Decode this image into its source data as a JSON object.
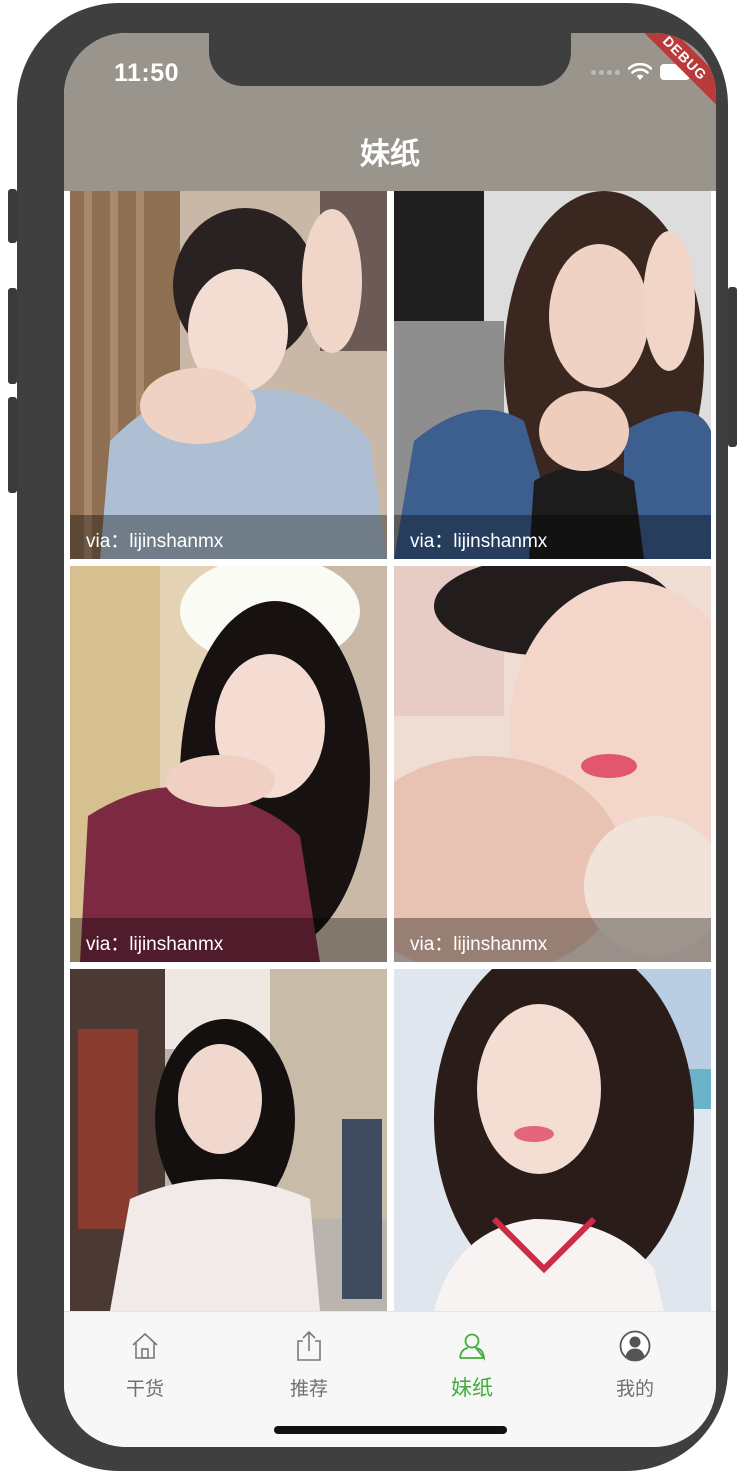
{
  "status_bar": {
    "time": "11:50"
  },
  "debug_banner": "DEBUG",
  "app_bar": {
    "title": "妹纸"
  },
  "photos": [
    {
      "caption": "via：lijinshanmx"
    },
    {
      "caption": "via：lijinshanmx"
    },
    {
      "caption": "via：lijinshanmx"
    },
    {
      "caption": "via：lijinshanmx"
    },
    {
      "caption": ""
    },
    {
      "caption": ""
    }
  ],
  "tab_bar": {
    "tabs": [
      {
        "label": "干货",
        "icon": "home-icon",
        "active": false
      },
      {
        "label": "推荐",
        "icon": "share-icon",
        "active": false
      },
      {
        "label": "妹纸",
        "icon": "person-icon",
        "active": true
      },
      {
        "label": "我的",
        "icon": "account-circle-icon",
        "active": false
      }
    ],
    "active_color": "#3fae3a",
    "inactive_color": "#707070"
  },
  "colors": {
    "app_bar": "#99958c",
    "frame": "#3f3f3f"
  }
}
